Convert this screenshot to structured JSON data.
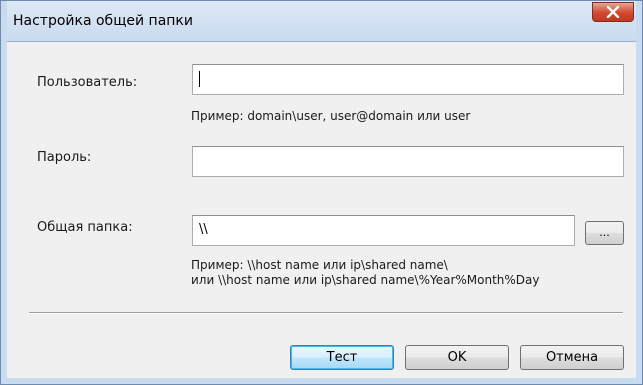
{
  "window": {
    "title": "Настройка общей папки",
    "close_icon": "close-icon"
  },
  "form": {
    "user": {
      "label": "Пользователь:",
      "value": "",
      "hint": "Пример: domain\\user, user@domain или user"
    },
    "password": {
      "label": "Пароль:",
      "value": ""
    },
    "shared_folder": {
      "label": "Общая папка:",
      "value": "\\\\",
      "browse_label": "...",
      "hint_line1": "Пример: \\\\host name или ip\\shared name\\",
      "hint_line2": "или \\\\host name или ip\\shared name\\%Year%Month%Day"
    }
  },
  "buttons": {
    "test": "Тест",
    "ok": "OK",
    "cancel": "Отмена"
  },
  "colors": {
    "close_button": "#c23a22",
    "default_button_border": "#3c7fb1",
    "title_bar": "#c9dbef"
  }
}
